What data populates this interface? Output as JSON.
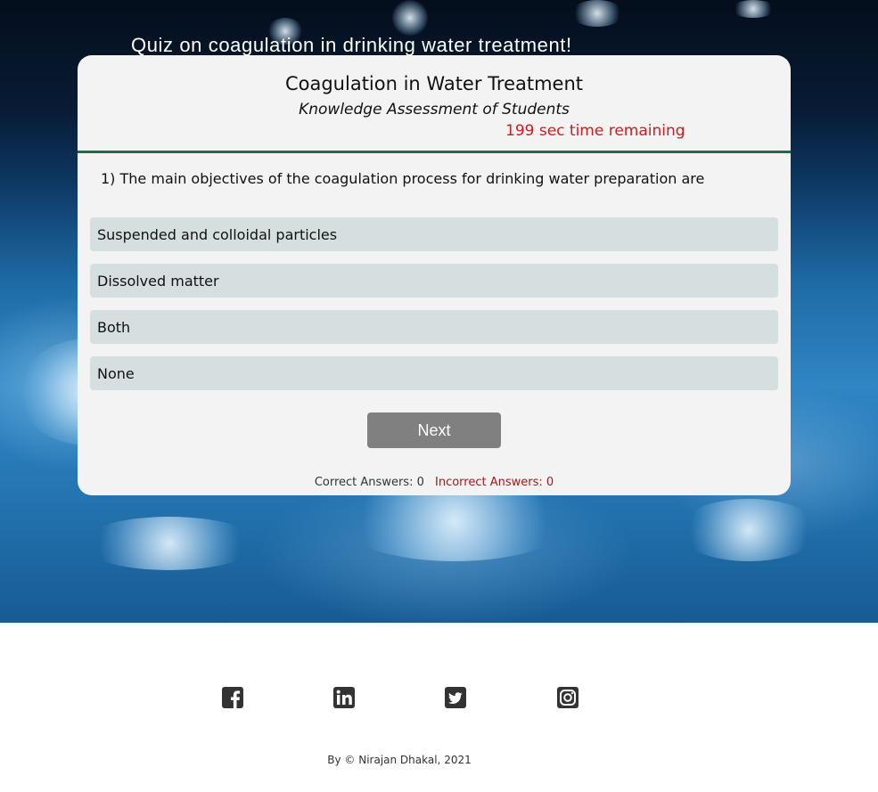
{
  "hero": {
    "title": "Quiz on coagulation in drinking water treatment!"
  },
  "quiz": {
    "title": "Coagulation in Water Treatment",
    "subtitle": "Knowledge Assessment of Students",
    "timer_text": "199 sec time remaining",
    "question": "1) The main objectives of the coagulation process for drinking water preparation are",
    "options": [
      {
        "label": "Suspended and colloidal particles"
      },
      {
        "label": "Dissolved matter"
      },
      {
        "label": "Both"
      },
      {
        "label": "None"
      }
    ],
    "next_label": "Next",
    "correct_text": "Correct Answers: 0",
    "incorrect_text": "Incorrect Answers: 0"
  },
  "footer": {
    "social_icons": [
      "facebook-icon",
      "linkedin-icon",
      "twitter-icon",
      "instagram-icon"
    ],
    "copyright": "By © Nirajan Dhakal, 2021"
  },
  "colors": {
    "card_background": "#f3f3f3",
    "header_divider": "#1f6a4a",
    "timer": "#d11a1a",
    "option_background": "#d6dfdf",
    "next_button": "#808080",
    "incorrect_text": "#a01a1a",
    "icon": "#333333"
  }
}
